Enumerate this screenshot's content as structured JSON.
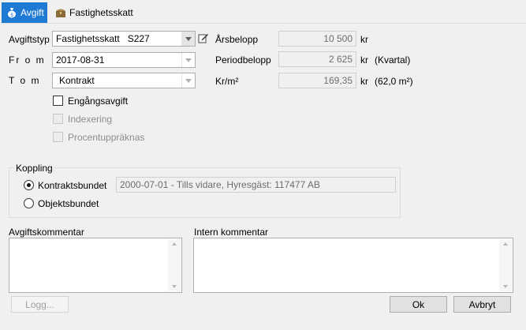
{
  "tabs": [
    {
      "label": "Avgift",
      "icon": "moneybag-icon",
      "active": true
    },
    {
      "label": "Fastighetsskatt",
      "icon": "treasure-chest-icon",
      "active": false
    }
  ],
  "form": {
    "avgiftstyp_label": "Avgiftstyp",
    "avgiftstyp_value": "Fastighetsskatt   S227",
    "from_label": "Fr o m",
    "from_value": "2017-08-31",
    "tom_label": "T o m",
    "tom_value": "Kontrakt",
    "engangsavgift_label": "Engångsavgift",
    "indexering_label": "Indexering",
    "procent_label": "Procentuppräknas",
    "arsbelopp_label": "Årsbelopp",
    "arsbelopp_value": "10 500",
    "arsbelopp_unit": "kr",
    "periodbelopp_label": "Periodbelopp",
    "periodbelopp_value": "2 625",
    "periodbelopp_unit": "kr",
    "periodbelopp_note": "(Kvartal)",
    "krm2_label": "Kr/m²",
    "krm2_value": "169,35",
    "krm2_unit": "kr",
    "krm2_note": "(62,0 m²)"
  },
  "koppling": {
    "title": "Koppling",
    "kontrakt_label": "Kontraktsbundet",
    "kontrakt_selected": true,
    "kontrakt_value": "2000-07-01 - Tills vidare, Hyresgäst: 117477 AB",
    "objekt_label": "Objektsbundet"
  },
  "comments": {
    "avgift_label": "Avgiftskommentar",
    "intern_label": "Intern kommentar"
  },
  "buttons": {
    "logg": "Logg...",
    "ok": "Ok",
    "avbryt": "Avbryt"
  },
  "colors": {
    "accent": "#1f7ad3"
  }
}
